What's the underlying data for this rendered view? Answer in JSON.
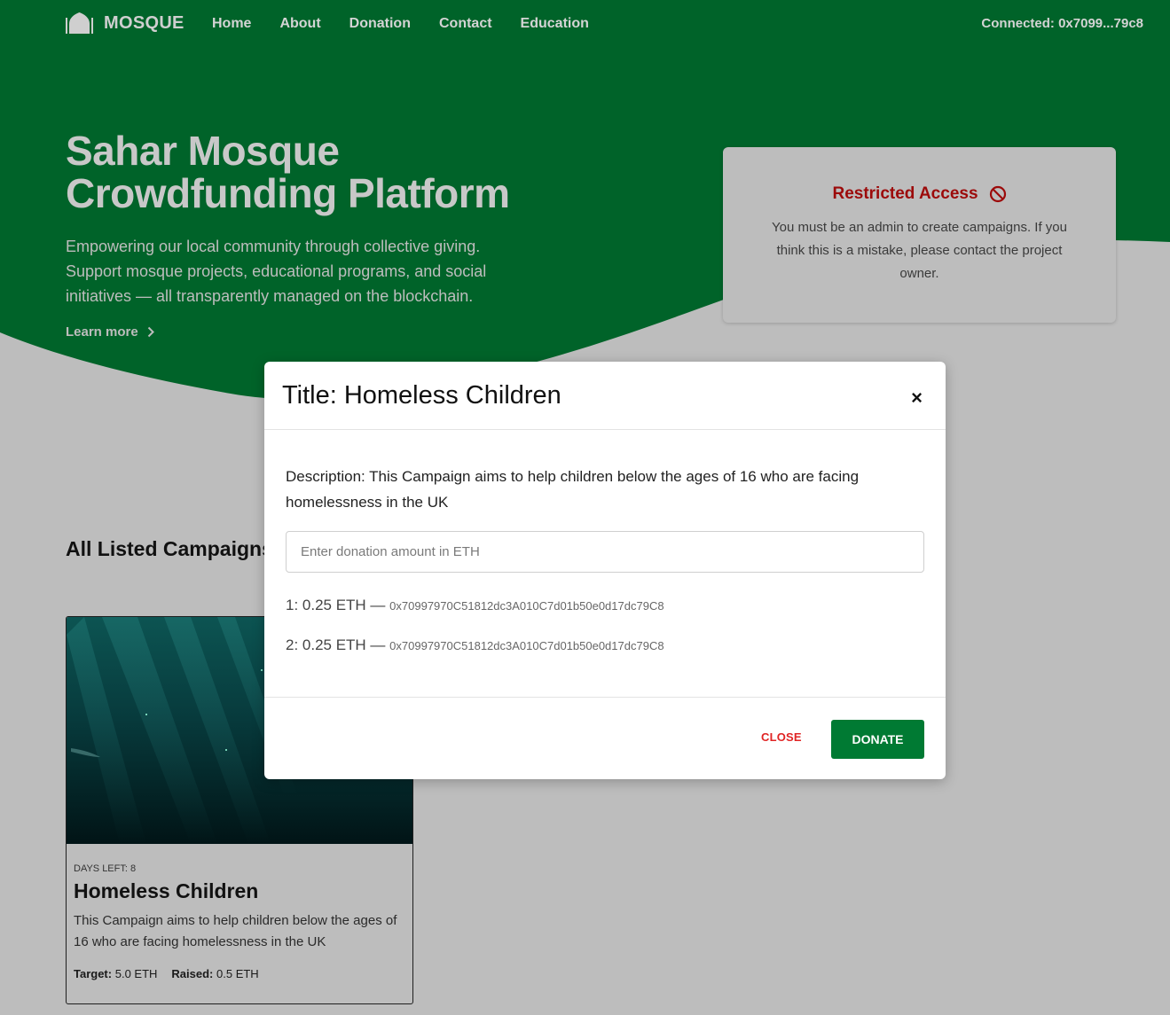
{
  "nav": {
    "brand": "MOSQUE",
    "links": [
      "Home",
      "About",
      "Donation",
      "Contact",
      "Education"
    ],
    "wallet": "Connected: 0x7099...79c8"
  },
  "hero": {
    "title_line1": "Sahar Mosque",
    "title_line2": "Crowdfunding Platform",
    "subtitle": "Empowering our local community through collective giving. Support mosque projects, educational programs, and social initiatives — all transparently managed on the blockchain.",
    "learn_more": "Learn more"
  },
  "restricted": {
    "title": "Restricted Access",
    "message": "You must be an admin to create campaigns. If you think this is a mistake, please contact the project owner."
  },
  "campaigns": {
    "section_title": "All Listed Campaigns",
    "card": {
      "days_left": "DAYS LEFT: 8",
      "title": "Homeless Children",
      "description": "This Campaign aims to help children below the ages of 16 who are facing homelessness in the UK",
      "target_label": "Target:",
      "target_value": "5.0 ETH",
      "raised_label": "Raised:",
      "raised_value": "0.5 ETH"
    }
  },
  "modal": {
    "title": "Title: Homeless Children",
    "close_icon": "×",
    "description": "Description: This Campaign aims to help children below the ages of 16 who are facing homelessness in the UK",
    "amount_placeholder": "Enter donation amount in ETH",
    "donations": [
      {
        "label": "1: 0.25 ETH —",
        "address": "0x70997970C51812dc3A010C7d01b50e0d17dc79C8"
      },
      {
        "label": "2: 0.25 ETH —",
        "address": "0x70997970C51812dc3A010C7d01b50e0d17dc79C8"
      }
    ],
    "close_label": "CLOSE",
    "donate_label": "DONATE"
  },
  "colors": {
    "brand_green": "#006329",
    "donate_green": "#007a33",
    "restricted_red": "#9c0a0a",
    "overlay_gray": "#bdbdbd"
  }
}
